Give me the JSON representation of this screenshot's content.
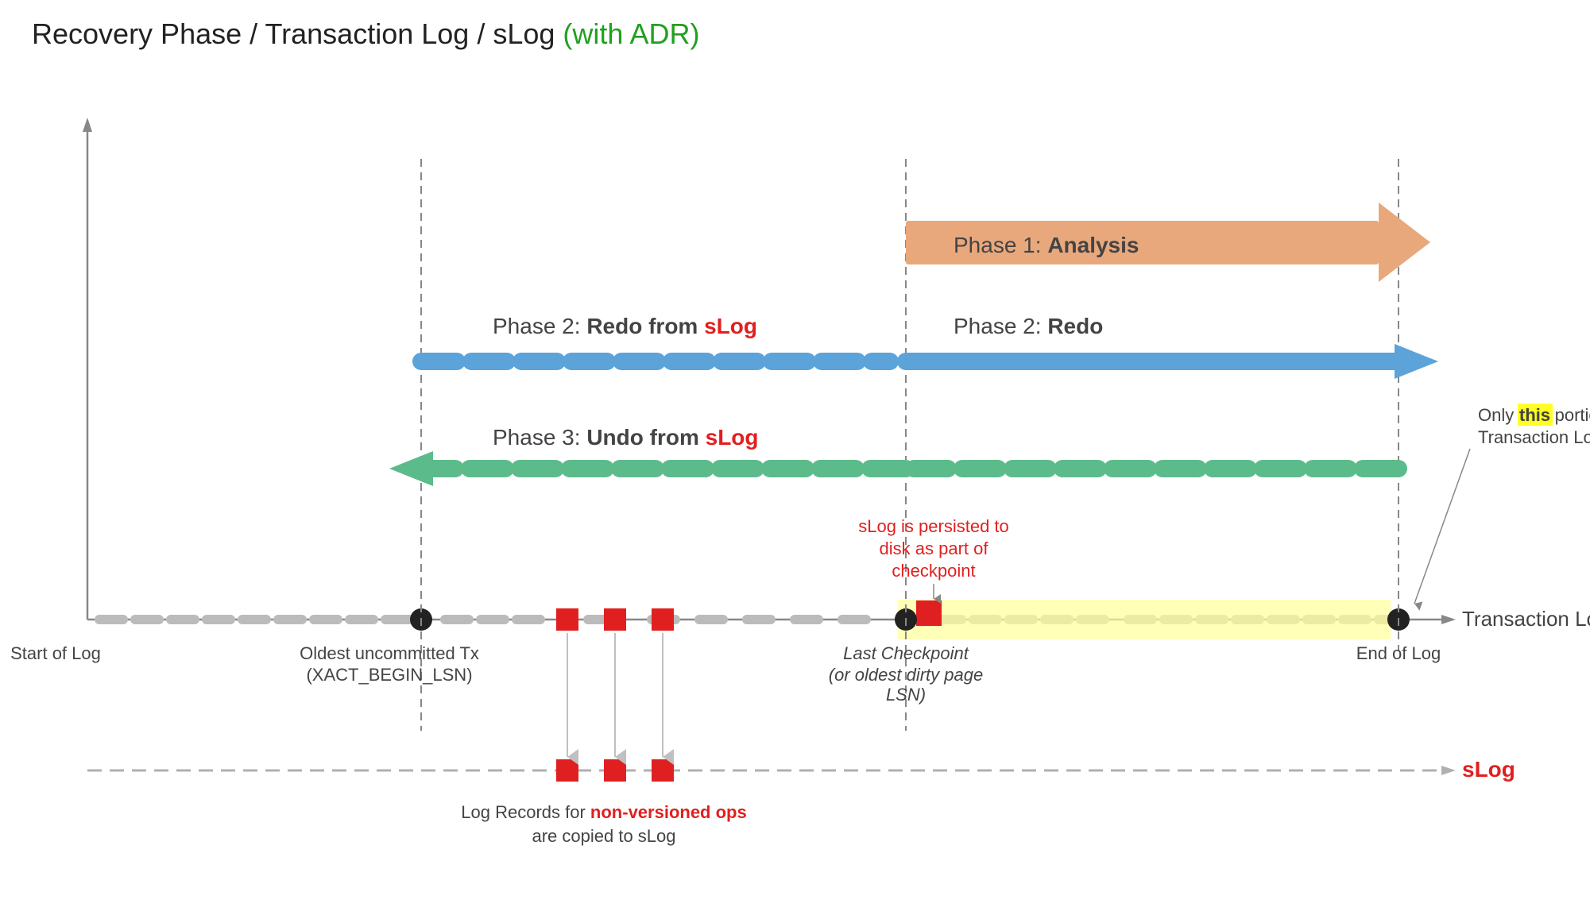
{
  "title": {
    "part1": "Recovery Phase",
    "separator1": " / ",
    "part2": "Transaction Log",
    "separator2": " / ",
    "part3": "sLog",
    "adr": " (with ADR)"
  },
  "phases": {
    "analysis": "Phase 1: Analysis",
    "redo_slog": "Phase 2: Redo from sLog",
    "redo": "Phase 2: Redo",
    "undo_slog": "Phase 3: Undo from sLog"
  },
  "labels": {
    "transaction_log": "Transaction Log",
    "slog": "sLog",
    "start_of_log": "Start of Log",
    "oldest_tx": "Oldest uncommitted Tx",
    "xact_begin_lsn": "(XACT_BEGIN_LSN)",
    "last_checkpoint": "Last Checkpoint",
    "oldest_dirty": "(or oldest dirty page",
    "lsn": "LSN)",
    "end_of_log": "End of Log",
    "slog_persisted": "sLog is persisted to",
    "slog_persisted2": "disk as part of",
    "slog_persisted3": "checkpoint",
    "only_this": "Only",
    "this_word": "this",
    "portion": "portion of the",
    "tx_log_scanned": "Transaction Log is scanned.",
    "log_records": "Log Records for",
    "non_versioned": "non-versioned ops",
    "copied": "are copied to sLog"
  },
  "colors": {
    "analysis_arrow": "#E8A87C",
    "redo_arrow": "#5BA3D9",
    "undo_arrow": "#5CBB8A",
    "red": "#e02020",
    "green_text": "#22a020",
    "dashed_gray": "#b0b0b0",
    "yellow_highlight": "#ffff99"
  }
}
